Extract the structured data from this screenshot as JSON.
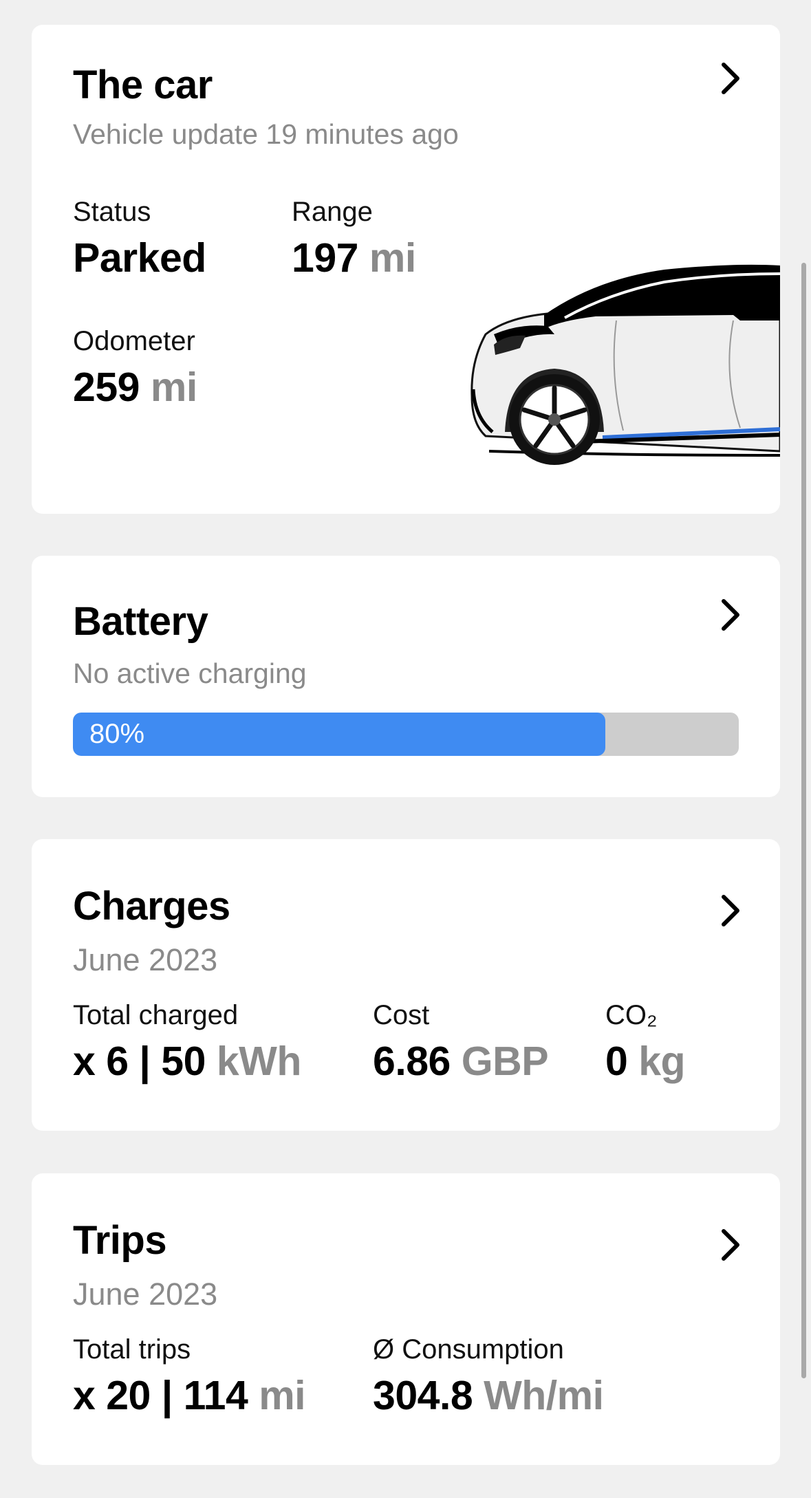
{
  "car": {
    "title": "The car",
    "subtitle": "Vehicle update 19 minutes ago",
    "status_label": "Status",
    "status_value": "Parked",
    "range_label": "Range",
    "range_value": "197",
    "range_unit": "mi",
    "odometer_label": "Odometer",
    "odometer_value": "259",
    "odometer_unit": "mi",
    "icon": "chevron-right-icon",
    "image": "car-illustration"
  },
  "battery": {
    "title": "Battery",
    "subtitle": "No active charging",
    "level_text": "80%",
    "level_percent": 80,
    "fill_color": "#3f8bf2",
    "track_color": "#cdcdcd",
    "icon": "chevron-right-icon"
  },
  "charges": {
    "title": "Charges",
    "subtitle": "June 2023",
    "total_label": "Total charged",
    "total_value": "x 6 | 50",
    "total_unit": "kWh",
    "cost_label": "Cost",
    "cost_value": "6.86",
    "cost_unit": "GBP",
    "co2_label": "CO₂",
    "co2_value": "0",
    "co2_unit": "kg",
    "icon": "chevron-right-icon"
  },
  "trips": {
    "title": "Trips",
    "subtitle": "June 2023",
    "total_label": "Total trips",
    "total_value": "x 20 | 114",
    "total_unit": "mi",
    "consumption_label": "Ø Consumption",
    "consumption_value": "304.8",
    "consumption_unit": "Wh/mi",
    "icon": "chevron-right-icon"
  },
  "colors": {
    "background": "#f0f0f0",
    "card": "#ffffff",
    "muted_text": "#8a8a8a",
    "accent": "#3f8bf2"
  }
}
